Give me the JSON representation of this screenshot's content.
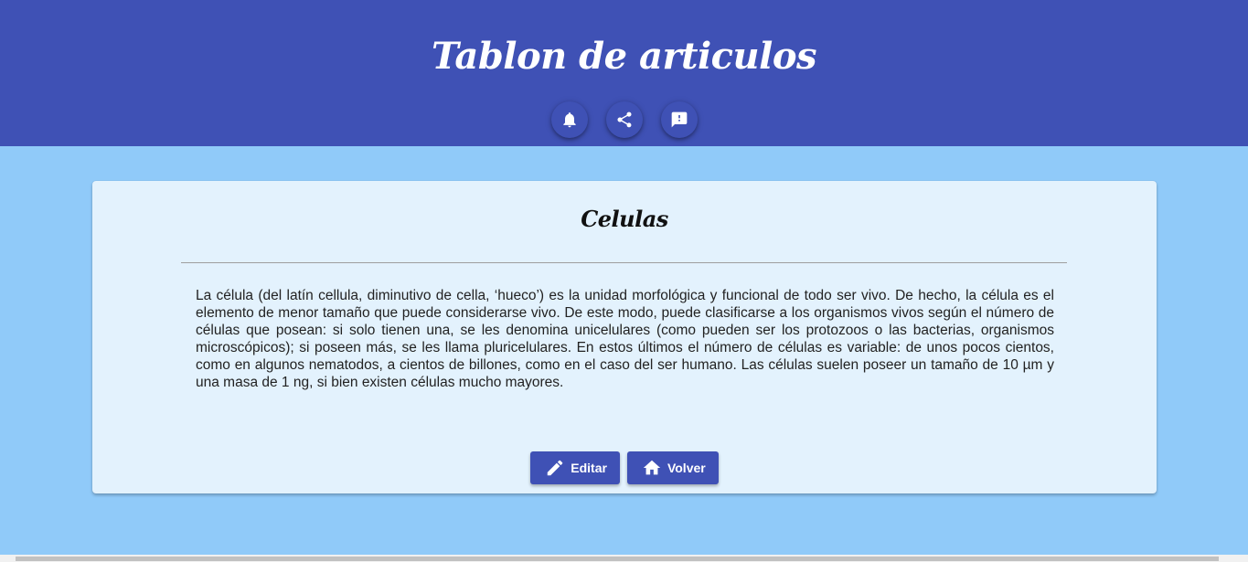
{
  "header": {
    "title": "Tablon de articulos",
    "background_color": "#3f51b5",
    "actions": [
      {
        "icon": "bell-icon",
        "label": "notifications"
      },
      {
        "icon": "share-icon",
        "label": "share"
      },
      {
        "icon": "feedback-icon",
        "label": "feedback"
      }
    ]
  },
  "page": {
    "background_color": "#90caf9"
  },
  "article": {
    "title": "Celulas",
    "body": "La célula (del latín cellula, diminutivo de cella, ‘hueco’) es la unidad morfológica y funcional de todo ser vivo. De hecho, la célula es el elemento de menor tamaño que puede considerarse vivo. De este modo, puede clasificarse a los organismos vivos según el número de células que posean: si solo tienen una, se les denomina unicelulares (como pueden ser los protozoos o las bacterias, organismos microscópicos); si poseen más, se les llama pluricelulares. En estos últimos el número de células es variable: de unos pocos cientos, como en algunos nematodos, a cientos de billones, como en el caso del ser humano. Las células suelen poseer un tamaño de 10 µm y una masa de 1 ng, si bien existen células mucho mayores.",
    "card_color": "#e3f2fd",
    "edit_label": "Editar",
    "back_label": "Volver"
  }
}
